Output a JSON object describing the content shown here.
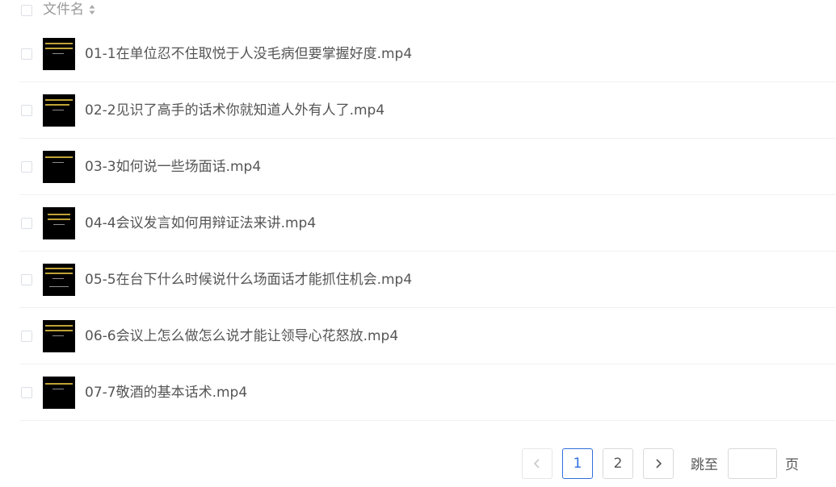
{
  "table": {
    "header": {
      "filename_label": "文件名"
    },
    "rows": [
      {
        "name": "01-1在单位忍不住取悦于人没毛病但要掌握好度.mp4"
      },
      {
        "name": "02-2见识了高手的话术你就知道人外有人了.mp4"
      },
      {
        "name": "03-3如何说一些场面话.mp4"
      },
      {
        "name": "04-4会议发言如何用辩证法来讲.mp4"
      },
      {
        "name": "05-5在台下什么时候说什么场面话才能抓住机会.mp4"
      },
      {
        "name": "06-6会议上怎么做怎么说才能让领导心花怒放.mp4"
      },
      {
        "name": "07-7敬酒的基本话术.mp4"
      }
    ]
  },
  "pagination": {
    "prev_icon": "chevron-left-icon",
    "pages": [
      "1",
      "2"
    ],
    "current_page": "1",
    "next_icon": "chevron-right-icon",
    "jump_label": "跳至",
    "jump_value": "",
    "page_suffix": "页"
  },
  "colors": {
    "accent": "#2f6fdd",
    "text": "#555555",
    "muted": "#999999",
    "border": "#d9d9d9"
  }
}
